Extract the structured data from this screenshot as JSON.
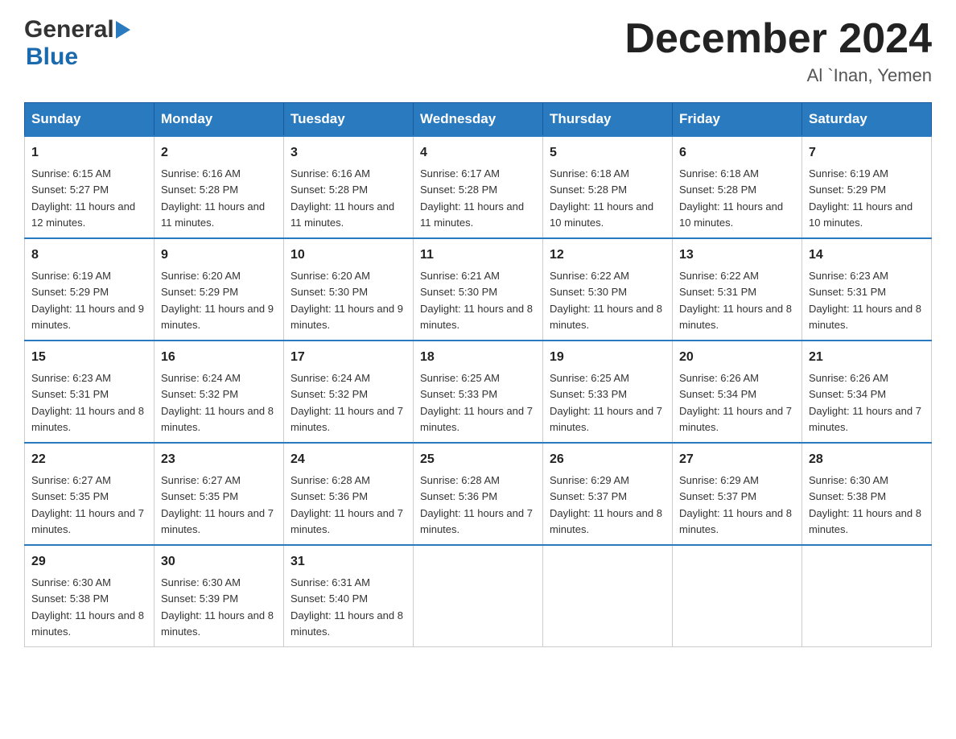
{
  "logo": {
    "general": "General",
    "blue": "Blue",
    "triangle": "▶"
  },
  "title": "December 2024",
  "subtitle": "Al `Inan, Yemen",
  "days": [
    "Sunday",
    "Monday",
    "Tuesday",
    "Wednesday",
    "Thursday",
    "Friday",
    "Saturday"
  ],
  "weeks": [
    [
      {
        "num": "1",
        "sunrise": "6:15 AM",
        "sunset": "5:27 PM",
        "daylight": "11 hours and 12 minutes."
      },
      {
        "num": "2",
        "sunrise": "6:16 AM",
        "sunset": "5:28 PM",
        "daylight": "11 hours and 11 minutes."
      },
      {
        "num": "3",
        "sunrise": "6:16 AM",
        "sunset": "5:28 PM",
        "daylight": "11 hours and 11 minutes."
      },
      {
        "num": "4",
        "sunrise": "6:17 AM",
        "sunset": "5:28 PM",
        "daylight": "11 hours and 11 minutes."
      },
      {
        "num": "5",
        "sunrise": "6:18 AM",
        "sunset": "5:28 PM",
        "daylight": "11 hours and 10 minutes."
      },
      {
        "num": "6",
        "sunrise": "6:18 AM",
        "sunset": "5:28 PM",
        "daylight": "11 hours and 10 minutes."
      },
      {
        "num": "7",
        "sunrise": "6:19 AM",
        "sunset": "5:29 PM",
        "daylight": "11 hours and 10 minutes."
      }
    ],
    [
      {
        "num": "8",
        "sunrise": "6:19 AM",
        "sunset": "5:29 PM",
        "daylight": "11 hours and 9 minutes."
      },
      {
        "num": "9",
        "sunrise": "6:20 AM",
        "sunset": "5:29 PM",
        "daylight": "11 hours and 9 minutes."
      },
      {
        "num": "10",
        "sunrise": "6:20 AM",
        "sunset": "5:30 PM",
        "daylight": "11 hours and 9 minutes."
      },
      {
        "num": "11",
        "sunrise": "6:21 AM",
        "sunset": "5:30 PM",
        "daylight": "11 hours and 8 minutes."
      },
      {
        "num": "12",
        "sunrise": "6:22 AM",
        "sunset": "5:30 PM",
        "daylight": "11 hours and 8 minutes."
      },
      {
        "num": "13",
        "sunrise": "6:22 AM",
        "sunset": "5:31 PM",
        "daylight": "11 hours and 8 minutes."
      },
      {
        "num": "14",
        "sunrise": "6:23 AM",
        "sunset": "5:31 PM",
        "daylight": "11 hours and 8 minutes."
      }
    ],
    [
      {
        "num": "15",
        "sunrise": "6:23 AM",
        "sunset": "5:31 PM",
        "daylight": "11 hours and 8 minutes."
      },
      {
        "num": "16",
        "sunrise": "6:24 AM",
        "sunset": "5:32 PM",
        "daylight": "11 hours and 8 minutes."
      },
      {
        "num": "17",
        "sunrise": "6:24 AM",
        "sunset": "5:32 PM",
        "daylight": "11 hours and 7 minutes."
      },
      {
        "num": "18",
        "sunrise": "6:25 AM",
        "sunset": "5:33 PM",
        "daylight": "11 hours and 7 minutes."
      },
      {
        "num": "19",
        "sunrise": "6:25 AM",
        "sunset": "5:33 PM",
        "daylight": "11 hours and 7 minutes."
      },
      {
        "num": "20",
        "sunrise": "6:26 AM",
        "sunset": "5:34 PM",
        "daylight": "11 hours and 7 minutes."
      },
      {
        "num": "21",
        "sunrise": "6:26 AM",
        "sunset": "5:34 PM",
        "daylight": "11 hours and 7 minutes."
      }
    ],
    [
      {
        "num": "22",
        "sunrise": "6:27 AM",
        "sunset": "5:35 PM",
        "daylight": "11 hours and 7 minutes."
      },
      {
        "num": "23",
        "sunrise": "6:27 AM",
        "sunset": "5:35 PM",
        "daylight": "11 hours and 7 minutes."
      },
      {
        "num": "24",
        "sunrise": "6:28 AM",
        "sunset": "5:36 PM",
        "daylight": "11 hours and 7 minutes."
      },
      {
        "num": "25",
        "sunrise": "6:28 AM",
        "sunset": "5:36 PM",
        "daylight": "11 hours and 7 minutes."
      },
      {
        "num": "26",
        "sunrise": "6:29 AM",
        "sunset": "5:37 PM",
        "daylight": "11 hours and 8 minutes."
      },
      {
        "num": "27",
        "sunrise": "6:29 AM",
        "sunset": "5:37 PM",
        "daylight": "11 hours and 8 minutes."
      },
      {
        "num": "28",
        "sunrise": "6:30 AM",
        "sunset": "5:38 PM",
        "daylight": "11 hours and 8 minutes."
      }
    ],
    [
      {
        "num": "29",
        "sunrise": "6:30 AM",
        "sunset": "5:38 PM",
        "daylight": "11 hours and 8 minutes."
      },
      {
        "num": "30",
        "sunrise": "6:30 AM",
        "sunset": "5:39 PM",
        "daylight": "11 hours and 8 minutes."
      },
      {
        "num": "31",
        "sunrise": "6:31 AM",
        "sunset": "5:40 PM",
        "daylight": "11 hours and 8 minutes."
      },
      null,
      null,
      null,
      null
    ]
  ]
}
